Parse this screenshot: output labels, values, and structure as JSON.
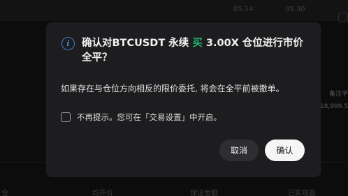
{
  "background": {
    "dates": [
      "05.14",
      "05.30"
    ],
    "side_texts": [
      "备注字",
      "18,999.5"
    ],
    "bottom_labels": [
      "仓",
      "均开价",
      "保证金额",
      "已实现盈"
    ]
  },
  "dialog": {
    "icon": "info-icon",
    "title_prefix": "确认对BTCUSDT 永续 ",
    "title_side": "买",
    "title_suffix": " 3.00X 仓位进行市价全平？",
    "description": "如果存在与仓位方向相反的限价委托, 将会在全平前被撤单。",
    "checkbox_label": "不再提示。您可在「交易设置」中开启。",
    "checkbox_checked": false,
    "cancel_label": "取消",
    "confirm_label": "确认"
  },
  "colors": {
    "accent_blue": "#3d7dd6",
    "buy_green": "#23b26d",
    "confirm_bg": "#f5f5f5",
    "modal_bg": "#1d1d1f"
  }
}
